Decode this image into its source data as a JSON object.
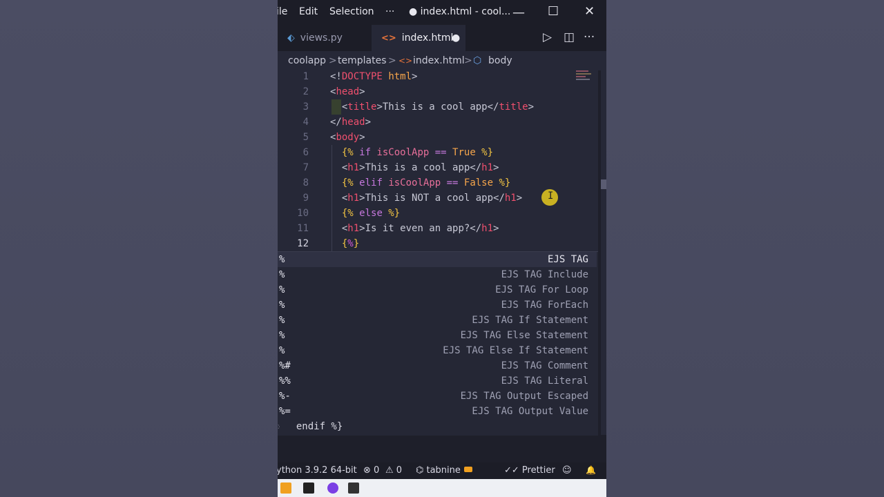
{
  "titlebar": {
    "menu": [
      "ile",
      "Edit",
      "Selection",
      "···"
    ],
    "title": "● index.html - cool...",
    "controls": {
      "minimize": "—",
      "maximize": "☐",
      "close": "✕"
    }
  },
  "tabs": [
    {
      "label": "views.py",
      "icon": "python-icon",
      "icon_glyph": "⬖",
      "active": false
    },
    {
      "label": "index.html",
      "icon": "html-icon",
      "icon_glyph": "<>",
      "active": true,
      "dirty": "●"
    }
  ],
  "tab_actions": {
    "run": "▷",
    "split": "◫",
    "more": "···"
  },
  "breadcrumb": [
    "coolapp",
    ">",
    "templates",
    ">",
    "<>",
    "index.html",
    ">",
    "⬡",
    "body"
  ],
  "editor": {
    "line_numbers": [
      "1",
      "2",
      "3",
      "4",
      "5",
      "6",
      "7",
      "8",
      "9",
      "10",
      "11",
      "12"
    ],
    "lines": [
      [
        [
          "t-br",
          "<!"
        ],
        [
          "t-kw",
          "DOCTYPE"
        ],
        [
          "t-br",
          " "
        ],
        [
          "t-bool",
          "html"
        ],
        [
          "t-br",
          ">"
        ]
      ],
      [
        [
          "t-br",
          "<"
        ],
        [
          "t-tag",
          "head"
        ],
        [
          "t-br",
          ">"
        ]
      ],
      [
        [
          "t-br",
          "  <"
        ],
        [
          "t-tag",
          "title"
        ],
        [
          "t-br",
          ">This is a cool app</"
        ],
        [
          "t-tag",
          "title"
        ],
        [
          "t-br",
          ">"
        ]
      ],
      [
        [
          "t-br",
          "</"
        ],
        [
          "t-tag",
          "head"
        ],
        [
          "t-br",
          ">"
        ]
      ],
      [
        [
          "t-br",
          "<"
        ],
        [
          "t-tag",
          "body"
        ],
        [
          "t-br",
          ">"
        ]
      ],
      [
        [
          "t-tmpl",
          "  {% "
        ],
        [
          "t-op",
          "if "
        ],
        [
          "t-var",
          "isCoolApp"
        ],
        [
          "t-op",
          " == "
        ],
        [
          "t-bool",
          "True"
        ],
        [
          "t-tmpl",
          " %}"
        ]
      ],
      [
        [
          "t-br",
          "  <"
        ],
        [
          "t-tag",
          "h1"
        ],
        [
          "t-br",
          ">This is a cool app</"
        ],
        [
          "t-tag",
          "h1"
        ],
        [
          "t-br",
          ">"
        ]
      ],
      [
        [
          "t-tmpl",
          "  {% "
        ],
        [
          "t-op",
          "elif "
        ],
        [
          "t-var",
          "isCoolApp"
        ],
        [
          "t-op",
          " == "
        ],
        [
          "t-bool",
          "False"
        ],
        [
          "t-tmpl",
          " %}"
        ]
      ],
      [
        [
          "t-br",
          "  <"
        ],
        [
          "t-tag",
          "h1"
        ],
        [
          "t-br",
          ">This is NOT a cool app</"
        ],
        [
          "t-tag",
          "h1"
        ],
        [
          "t-br",
          ">"
        ]
      ],
      [
        [
          "t-tmpl",
          "  {% "
        ],
        [
          "t-op",
          "else"
        ],
        [
          "t-tmpl",
          " %}"
        ]
      ],
      [
        [
          "t-br",
          "  <"
        ],
        [
          "t-tag",
          "h1"
        ],
        [
          "t-br",
          ">Is it even an app?</"
        ],
        [
          "t-tag",
          "h1"
        ],
        [
          "t-br",
          ">"
        ]
      ],
      [
        [
          "t-tmpl",
          "  {"
        ],
        [
          "t-mag",
          "%"
        ],
        [
          "t-tmpl",
          "}"
        ]
      ]
    ],
    "current_line": "12"
  },
  "suggestions": [
    {
      "label": "%",
      "desc": "EJS TAG",
      "selected": true
    },
    {
      "label": "%",
      "desc": "EJS TAG Include"
    },
    {
      "label": "%",
      "desc": "EJS TAG For Loop"
    },
    {
      "label": "%",
      "desc": "EJS TAG ForEach"
    },
    {
      "label": "%",
      "desc": "EJS TAG If Statement"
    },
    {
      "label": "%",
      "desc": "EJS TAG Else Statement"
    },
    {
      "label": "%",
      "desc": "EJS TAG Else If Statement"
    },
    {
      "label": "%#",
      "desc": "EJS TAG Comment"
    },
    {
      "label": "%%",
      "desc": "EJS TAG Literal"
    },
    {
      "label": "%-",
      "desc": "EJS TAG Output Escaped"
    },
    {
      "label": "%=",
      "desc": "EJS TAG Output Value"
    }
  ],
  "trailing_line": "  endif %}",
  "statusbar": {
    "python": "ython 3.9.2 64-bit",
    "errors": "⊗ 0",
    "warnings": "⚠ 0",
    "tabnine": "⌬ tabnine",
    "prettier": "✓✓ Prettier",
    "feedback": "☺",
    "bell": "🔔"
  },
  "colors": {
    "accent": "#f0506e",
    "template": "#f4c542",
    "bg": "#262837"
  }
}
